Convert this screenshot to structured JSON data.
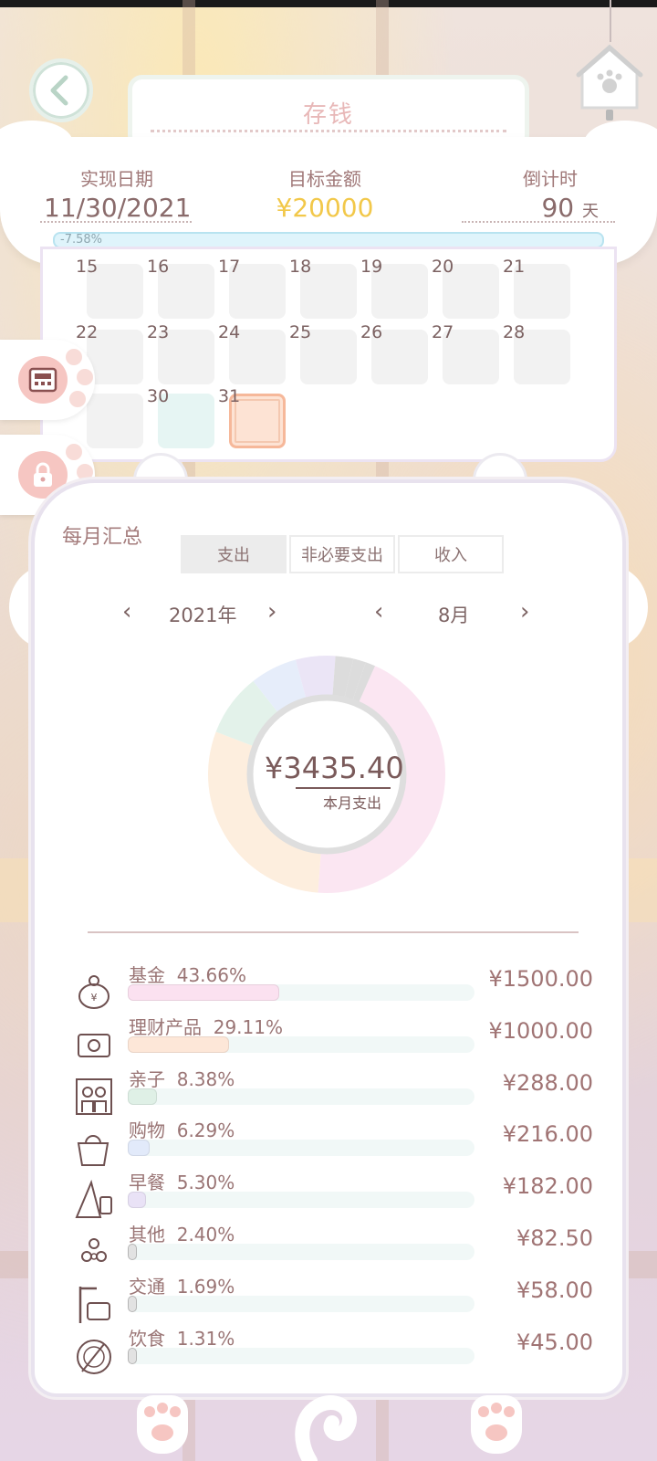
{
  "header": {
    "title": "存钱"
  },
  "summary": {
    "date_label": "实现日期",
    "date_value": "11/30/2021",
    "target_label": "目标金额",
    "target_value": "¥20000",
    "countdown_label": "倒计时",
    "countdown_value": "90",
    "countdown_unit": "天",
    "progress_text": "-7.58%",
    "progress_fraction": -0.0758
  },
  "calendar": {
    "rows": [
      [
        {
          "num": "15",
          "style": "gray"
        },
        {
          "num": "16",
          "style": "gray"
        },
        {
          "num": "17",
          "style": "gray"
        },
        {
          "num": "18",
          "style": "gray"
        },
        {
          "num": "19",
          "style": "gray"
        },
        {
          "num": "20",
          "style": "gray"
        },
        {
          "num": "21",
          "style": "gray"
        }
      ],
      [
        {
          "num": "22",
          "style": "gray"
        },
        {
          "num": "23",
          "style": "gray"
        },
        {
          "num": "24",
          "style": "gray"
        },
        {
          "num": "25",
          "style": "gray"
        },
        {
          "num": "26",
          "style": "gray"
        },
        {
          "num": "27",
          "style": "gray"
        },
        {
          "num": "28",
          "style": "gray"
        }
      ],
      [
        {
          "num": "",
          "style": "gray"
        },
        {
          "num": "30",
          "style": "teal"
        },
        {
          "num": "31",
          "style": "today"
        }
      ]
    ]
  },
  "side_buttons": [
    {
      "icon": "calculator-icon"
    },
    {
      "icon": "lock-icon"
    }
  ],
  "monthly": {
    "title": "每月汇总",
    "tabs": [
      {
        "label": "支出",
        "active": true
      },
      {
        "label": "非必要支出",
        "active": false
      },
      {
        "label": "收入",
        "active": false
      }
    ],
    "year": "2021年",
    "month": "8月",
    "prev_glyph": "‹",
    "next_glyph": "›",
    "total": "¥3435.40",
    "total_label": "本月支出",
    "chart_data": {
      "type": "pie",
      "categories": [
        "基金",
        "理财产品",
        "亲子",
        "购物",
        "早餐",
        "其他",
        "交通",
        "饮食"
      ],
      "values": [
        43.66,
        29.11,
        8.38,
        6.29,
        5.3,
        2.4,
        1.69,
        1.31
      ],
      "colors": [
        "#fbe6f2",
        "#fdeede",
        "#e3f2ea",
        "#e6edfa",
        "#ebe5f6",
        "#dcdcdc",
        "#dcdcdc",
        "#dcdcdc"
      ]
    },
    "items": [
      {
        "name": "基金",
        "percent": "43.66%",
        "fraction": 0.4366,
        "amount": "¥1500.00",
        "color": "#fbe1f0",
        "icon": "piggy-bank-icon"
      },
      {
        "name": "理财产品",
        "percent": "29.11%",
        "fraction": 0.2911,
        "amount": "¥1000.00",
        "color": "#fde7d8",
        "icon": "wallet-icon"
      },
      {
        "name": "亲子",
        "percent": "8.38%",
        "fraction": 0.0838,
        "amount": "¥288.00",
        "color": "#dff0e6",
        "icon": "family-icon"
      },
      {
        "name": "购物",
        "percent": "6.29%",
        "fraction": 0.0629,
        "amount": "¥216.00",
        "color": "#e2eafa",
        "icon": "shopping-bag-icon"
      },
      {
        "name": "早餐",
        "percent": "5.30%",
        "fraction": 0.053,
        "amount": "¥182.00",
        "color": "#e9e2f6",
        "icon": "sandwich-icon"
      },
      {
        "name": "其他",
        "percent": "2.40%",
        "fraction": 0.024,
        "amount": "¥82.50",
        "color": "#e2e2e2",
        "icon": "other-icon"
      },
      {
        "name": "交通",
        "percent": "1.69%",
        "fraction": 0.0169,
        "amount": "¥58.00",
        "color": "#e2e2e2",
        "icon": "transport-icon"
      },
      {
        "name": "饮食",
        "percent": "1.31%",
        "fraction": 0.0131,
        "amount": "¥45.00",
        "color": "#e2e2e2",
        "icon": "dining-icon"
      }
    ]
  }
}
